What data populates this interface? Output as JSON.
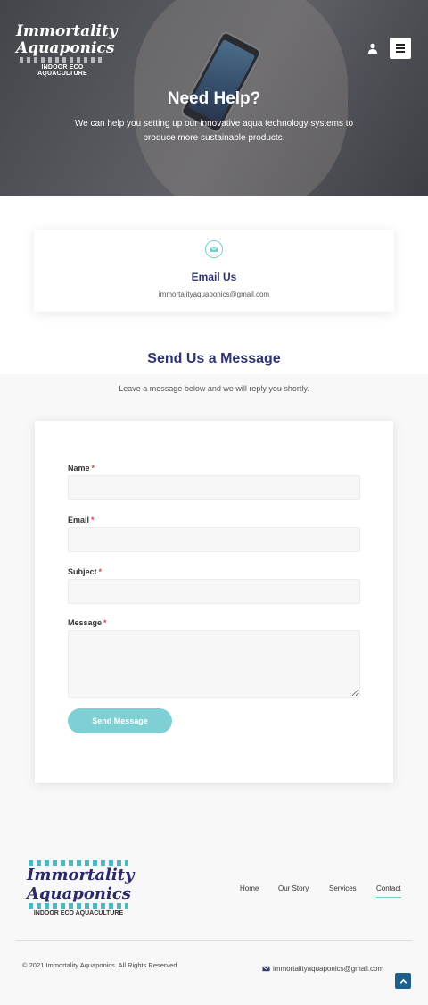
{
  "header": {
    "logo": {
      "line1": "Immortality",
      "line2": "Aquaponics",
      "tagline": "INDOOR ECO AQUACULTURE"
    },
    "icons": [
      "user-icon",
      "menu-icon"
    ]
  },
  "hero": {
    "title": "Need Help?",
    "text": "We can help you setting up our innovative aqua technology systems to produce more sustainable products."
  },
  "email_card": {
    "icon": "envelope-icon",
    "title": "Email Us",
    "address": "immortalityaquaponics@gmail.com"
  },
  "message_section": {
    "title": "Send Us a Message",
    "subtitle": "Leave a message below and we will reply you shortly."
  },
  "form": {
    "fields": [
      {
        "label": "Name",
        "required": "*",
        "value": ""
      },
      {
        "label": "Email",
        "required": "*",
        "value": ""
      },
      {
        "label": "Subject",
        "required": "*",
        "value": ""
      },
      {
        "label": "Message",
        "required": "*",
        "value": ""
      }
    ],
    "submit_label": "Send Message"
  },
  "footer": {
    "logo": {
      "line1": "Immortality",
      "line2": "Aquaponics",
      "tagline": "INDOOR ECO AQUACULTURE"
    },
    "nav": [
      {
        "label": "Home"
      },
      {
        "label": "Our Story"
      },
      {
        "label": "Services"
      },
      {
        "label": "Contact",
        "active": true
      }
    ],
    "copyright": "© 2021 Immortality Aquaponics. All Rights Reserved.",
    "email": "immortalityaquaponics@gmail.com"
  },
  "colors": {
    "accent": "#6fcfcf",
    "heading": "#2e3470",
    "button": "#7fd0d4",
    "required": "#e04444",
    "scroll_top": "#1f5f8b"
  }
}
